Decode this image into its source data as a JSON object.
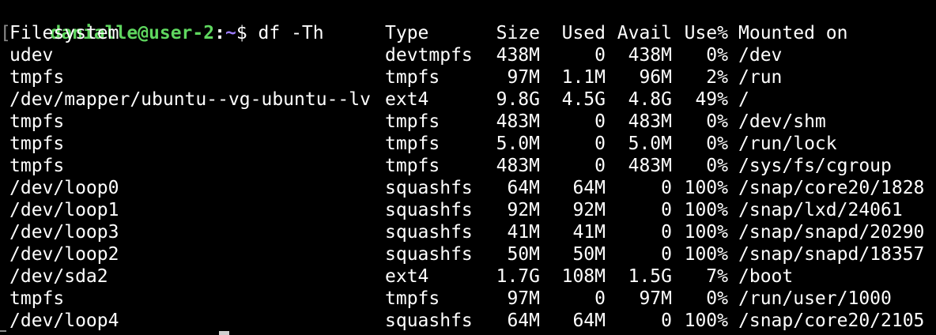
{
  "prompt": {
    "bracket": "[",
    "user_host": "danialle@user-2",
    "sep": ":",
    "path": "~",
    "dollar": "$ ",
    "command": "df -Th"
  },
  "table": {
    "headers": {
      "filesystem": "Filesystem",
      "type": "Type",
      "size": "Size",
      "used": "Used",
      "avail": "Avail",
      "use": "Use%",
      "mounted": "Mounted on"
    },
    "rows": [
      {
        "filesystem": "udev",
        "type": "devtmpfs",
        "size": "438M",
        "used": "0",
        "avail": "438M",
        "use": "0%",
        "mounted": "/dev"
      },
      {
        "filesystem": "tmpfs",
        "type": "tmpfs",
        "size": "97M",
        "used": "1.1M",
        "avail": "96M",
        "use": "2%",
        "mounted": "/run"
      },
      {
        "filesystem": "/dev/mapper/ubuntu--vg-ubuntu--lv",
        "type": "ext4",
        "size": "9.8G",
        "used": "4.5G",
        "avail": "4.8G",
        "use": "49%",
        "mounted": "/"
      },
      {
        "filesystem": "tmpfs",
        "type": "tmpfs",
        "size": "483M",
        "used": "0",
        "avail": "483M",
        "use": "0%",
        "mounted": "/dev/shm"
      },
      {
        "filesystem": "tmpfs",
        "type": "tmpfs",
        "size": "5.0M",
        "used": "0",
        "avail": "5.0M",
        "use": "0%",
        "mounted": "/run/lock"
      },
      {
        "filesystem": "tmpfs",
        "type": "tmpfs",
        "size": "483M",
        "used": "0",
        "avail": "483M",
        "use": "0%",
        "mounted": "/sys/fs/cgroup"
      },
      {
        "filesystem": "/dev/loop0",
        "type": "squashfs",
        "size": "64M",
        "used": "64M",
        "avail": "0",
        "use": "100%",
        "mounted": "/snap/core20/1828"
      },
      {
        "filesystem": "/dev/loop1",
        "type": "squashfs",
        "size": "92M",
        "used": "92M",
        "avail": "0",
        "use": "100%",
        "mounted": "/snap/lxd/24061"
      },
      {
        "filesystem": "/dev/loop3",
        "type": "squashfs",
        "size": "41M",
        "used": "41M",
        "avail": "0",
        "use": "100%",
        "mounted": "/snap/snapd/20290"
      },
      {
        "filesystem": "/dev/loop2",
        "type": "squashfs",
        "size": "50M",
        "used": "50M",
        "avail": "0",
        "use": "100%",
        "mounted": "/snap/snapd/18357"
      },
      {
        "filesystem": "/dev/sda2",
        "type": "ext4",
        "size": "1.7G",
        "used": "108M",
        "avail": "1.5G",
        "use": "7%",
        "mounted": "/boot"
      },
      {
        "filesystem": "tmpfs",
        "type": "tmpfs",
        "size": "97M",
        "used": "0",
        "avail": "97M",
        "use": "0%",
        "mounted": "/run/user/1000"
      },
      {
        "filesystem": "/dev/loop4",
        "type": "squashfs",
        "size": "64M",
        "used": "64M",
        "avail": "0",
        "use": "100%",
        "mounted": "/snap/core20/2105"
      }
    ]
  },
  "colors": {
    "background": "#000000",
    "text": "#ffffff",
    "prompt_user": "#5fd75f",
    "prompt_path": "#9d7bff"
  }
}
